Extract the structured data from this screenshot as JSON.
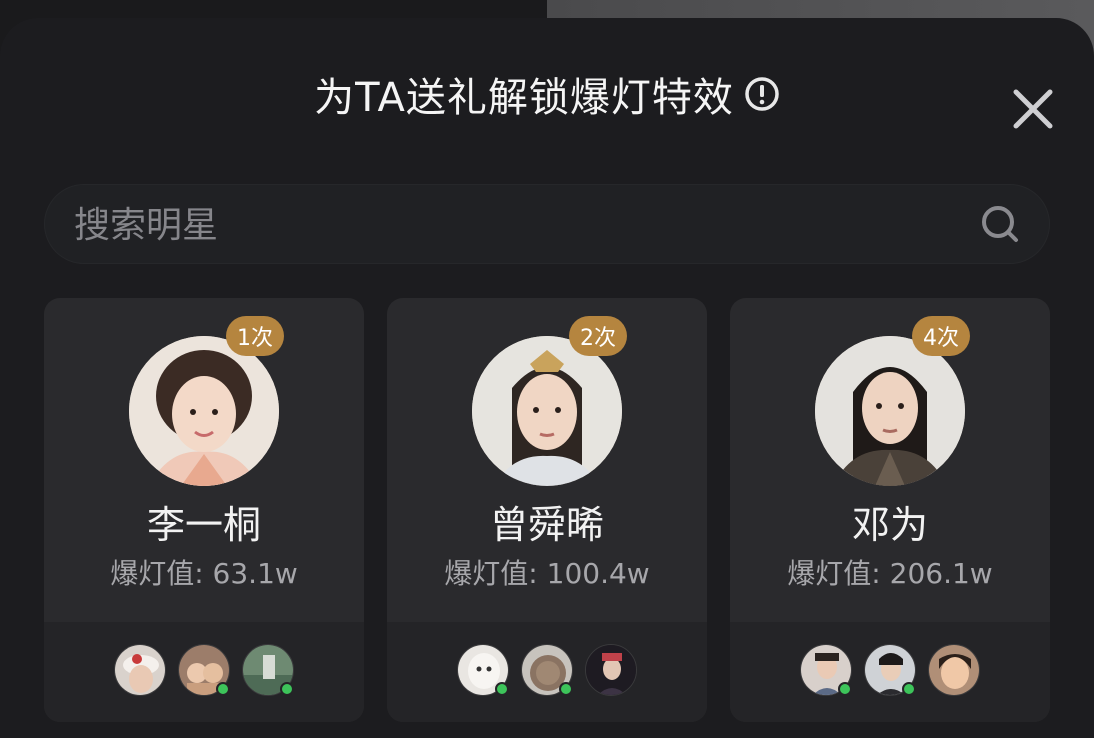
{
  "header": {
    "title": "为TA送礼解锁爆灯特效",
    "info_icon": "info-circle-icon",
    "close_icon": "close-icon"
  },
  "search": {
    "placeholder": "搜索明星",
    "value": "",
    "icon": "search-icon"
  },
  "colors": {
    "sheet_bg": "#1c1c1f",
    "card_bg": "#2a2a2d",
    "badge_bg": "#b5853f",
    "online": "#3dc45a"
  },
  "stars": [
    {
      "name": "李一桐",
      "count_badge": "1次",
      "score_text": "爆灯值: 63.1w",
      "fans": [
        {
          "online": false
        },
        {
          "online": true
        },
        {
          "online": true
        }
      ]
    },
    {
      "name": "曾舜晞",
      "count_badge": "2次",
      "score_text": "爆灯值: 100.4w",
      "fans": [
        {
          "online": true
        },
        {
          "online": true
        },
        {
          "online": false
        }
      ]
    },
    {
      "name": "邓为",
      "count_badge": "4次",
      "score_text": "爆灯值: 206.1w",
      "fans": [
        {
          "online": true
        },
        {
          "online": true
        },
        {
          "online": false
        }
      ]
    }
  ]
}
